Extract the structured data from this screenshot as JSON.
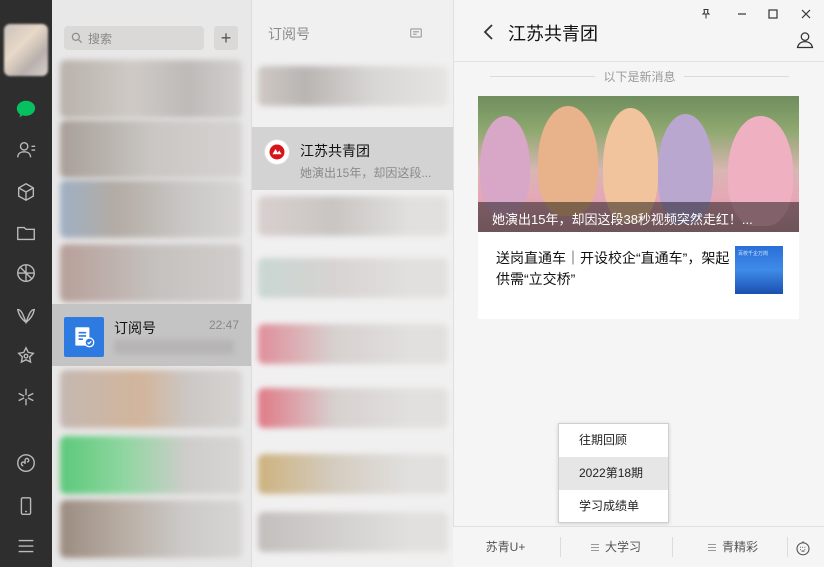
{
  "sidebar": {
    "icons": [
      "chat-icon",
      "contacts-icon",
      "favorites-icon",
      "files-icon",
      "moments-icon",
      "channels-icon",
      "search-spark-icon",
      "mini-program-icon",
      "phone-icon",
      "menu-icon"
    ]
  },
  "chatlist": {
    "search_placeholder": "搜索",
    "add_label": "+",
    "subscription_item": {
      "name": "订阅号",
      "time": "22:47"
    }
  },
  "sublist": {
    "header": "订阅号",
    "active_account": {
      "name": "江苏共青团",
      "preview": "她演出15年，却因这段..."
    }
  },
  "chat": {
    "title": "江苏共青团",
    "new_messages_divider": "以下是新消息",
    "article": {
      "caption": "她演出15年，却因这段38秒视频突然走红！...",
      "sub_title": "送岗直通车｜开设校企“直通车”，架起供需“立交桥”",
      "thumb_text": "百校千企万岗"
    }
  },
  "popup_menu": {
    "items": [
      "往期回顾",
      "2022第18期",
      "学习成绩单"
    ],
    "selected_index": 1
  },
  "menubar": {
    "items": [
      "苏青U+",
      "大学习",
      "青精彩"
    ]
  },
  "window_controls": {
    "pin": "pin-icon",
    "minimize": "minimize-icon",
    "maximize": "maximize-icon",
    "close": "close-icon"
  },
  "colors": {
    "rail_bg": "#2e2e2e",
    "accent_green": "#07c160",
    "subscription_blue": "#2d7ae0"
  }
}
